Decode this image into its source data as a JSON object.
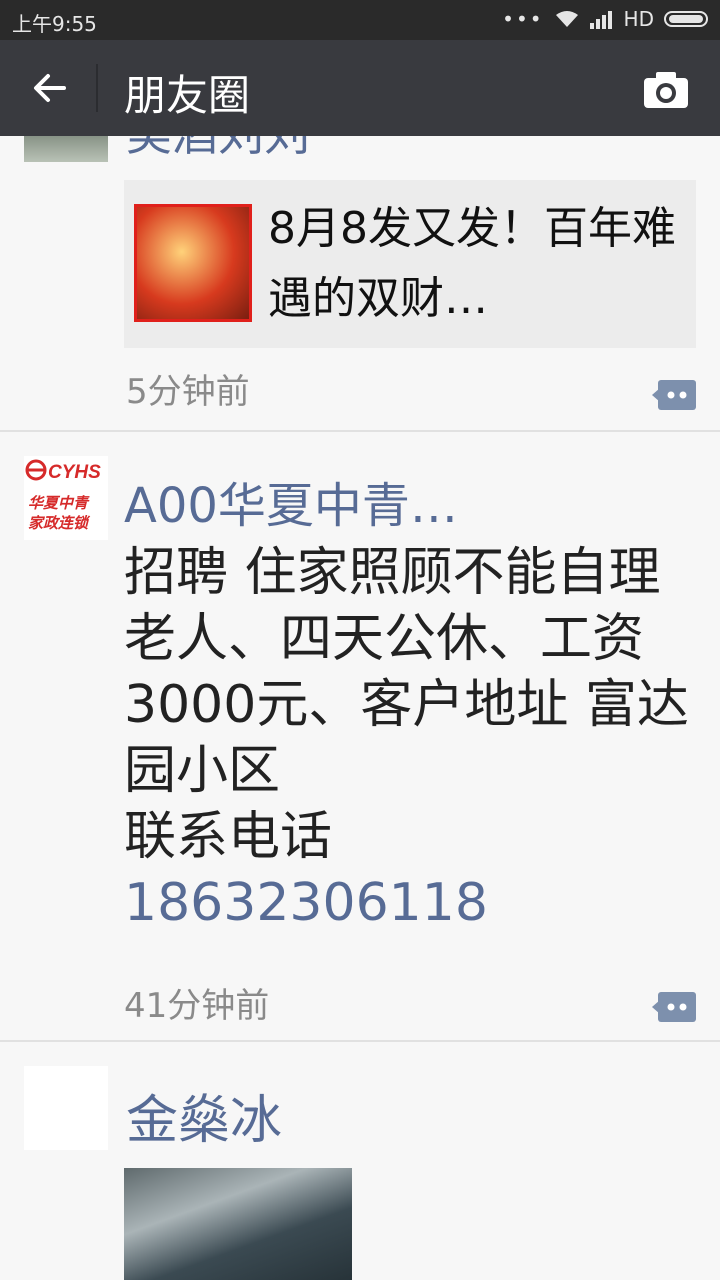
{
  "status_bar": {
    "time": "上午9:55",
    "dots": "•••",
    "network": "HD"
  },
  "app_bar": {
    "back_icon": "arrow-left-icon",
    "title": "朋友圈",
    "camera_icon": "camera-icon"
  },
  "posts": [
    {
      "name_partial": "美酒刘刘",
      "shared_link_title": "8月8发又发！百年难遇的双财…",
      "time": "5分钟前"
    },
    {
      "name": "A00华夏中青…",
      "text": "招聘 住家照顾不能自理老人、四天公休、工资 3000元、客户地址 富达园小区\n联系电话",
      "phone": "18632306118",
      "time": "41分钟前",
      "avatar_text_1": "CYHS",
      "avatar_text_2": "华夏中青",
      "avatar_text_3": "家政连锁"
    },
    {
      "name": "金燊冰"
    }
  ],
  "colors": {
    "link_blue": "#576b95",
    "appbar_bg": "#393a3f",
    "statusbar_bg": "#2a2a2a"
  }
}
